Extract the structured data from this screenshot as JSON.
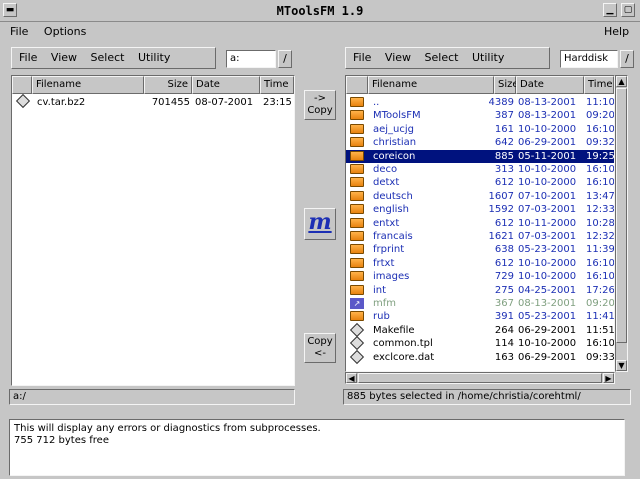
{
  "window": {
    "title": "MToolsFM 1.9"
  },
  "menubar": {
    "file": "File",
    "options": "Options",
    "help": "Help"
  },
  "left_panel": {
    "menu": [
      "File",
      "View",
      "Select",
      "Utility"
    ],
    "path": "a:",
    "slash": "/",
    "columns": [
      "Filename",
      "Size",
      "Date",
      "Time"
    ],
    "rows": [
      {
        "icon": "file-icon",
        "name": "cv.tar.bz2",
        "size": "701455",
        "date": "08-07-2001",
        "time": "23:15"
      }
    ],
    "status": "a:/"
  },
  "center": {
    "copy_right_arrow": "->",
    "copy_right_label": "Copy",
    "logo": "m",
    "copy_left_label": "Copy",
    "copy_left_arrow": "<-"
  },
  "right_panel": {
    "menu": [
      "File",
      "View",
      "Select",
      "Utility"
    ],
    "path": "Harddisk",
    "slash": "/",
    "columns": [
      "Filename",
      "Size",
      "Date",
      "Time"
    ],
    "rows": [
      {
        "icon": "folder-icon",
        "name": "..",
        "size": "4389",
        "date": "08-13-2001",
        "time": "11:10",
        "style": "blue"
      },
      {
        "icon": "folder-icon",
        "name": "MToolsFM",
        "size": "387",
        "date": "08-13-2001",
        "time": "09:20",
        "style": "blue"
      },
      {
        "icon": "folder-icon",
        "name": "aej_ucjg",
        "size": "161",
        "date": "10-10-2000",
        "time": "16:10",
        "style": "blue"
      },
      {
        "icon": "folder-icon",
        "name": "christian",
        "size": "642",
        "date": "06-29-2001",
        "time": "09:32",
        "style": "blue"
      },
      {
        "icon": "folder-icon",
        "name": "coreicon",
        "size": "885",
        "date": "05-11-2001",
        "time": "19:25",
        "style": "sel"
      },
      {
        "icon": "folder-icon",
        "name": "deco",
        "size": "313",
        "date": "10-10-2000",
        "time": "16:10",
        "style": "blue"
      },
      {
        "icon": "folder-icon",
        "name": "detxt",
        "size": "612",
        "date": "10-10-2000",
        "time": "16:10",
        "style": "blue"
      },
      {
        "icon": "folder-icon",
        "name": "deutsch",
        "size": "1607",
        "date": "07-10-2001",
        "time": "13:47",
        "style": "blue"
      },
      {
        "icon": "folder-icon",
        "name": "english",
        "size": "1592",
        "date": "07-03-2001",
        "time": "12:33",
        "style": "blue"
      },
      {
        "icon": "folder-icon",
        "name": "entxt",
        "size": "612",
        "date": "10-11-2000",
        "time": "10:28",
        "style": "blue"
      },
      {
        "icon": "folder-icon",
        "name": "francais",
        "size": "1621",
        "date": "07-03-2001",
        "time": "12:32",
        "style": "blue"
      },
      {
        "icon": "folder-icon",
        "name": "frprint",
        "size": "638",
        "date": "05-23-2001",
        "time": "11:39",
        "style": "blue"
      },
      {
        "icon": "folder-icon",
        "name": "frtxt",
        "size": "612",
        "date": "10-10-2000",
        "time": "16:10",
        "style": "blue"
      },
      {
        "icon": "folder-icon",
        "name": "images",
        "size": "729",
        "date": "10-10-2000",
        "time": "16:10",
        "style": "blue"
      },
      {
        "icon": "folder-icon",
        "name": "int",
        "size": "275",
        "date": "04-25-2001",
        "time": "17:26",
        "style": "blue"
      },
      {
        "icon": "link-icon",
        "name": "mfm",
        "size": "367",
        "date": "08-13-2001",
        "time": "09:20",
        "style": "gray"
      },
      {
        "icon": "folder-icon",
        "name": "rub",
        "size": "391",
        "date": "05-23-2001",
        "time": "11:41",
        "style": "blue"
      },
      {
        "icon": "file-icon",
        "name": "Makefile",
        "size": "264",
        "date": "06-29-2001",
        "time": "11:51",
        "style": "plain"
      },
      {
        "icon": "file-icon",
        "name": "common.tpl",
        "size": "114",
        "date": "10-10-2000",
        "time": "16:10",
        "style": "plain"
      },
      {
        "icon": "file-icon",
        "name": "exclcore.dat",
        "size": "163",
        "date": "06-29-2001",
        "time": "09:33",
        "style": "plain"
      }
    ],
    "status": "885 bytes selected in /home/christia/corehtml/"
  },
  "messages": {
    "line1": "This will display any errors or diagnostics from subprocesses.",
    "line2": "755 712 bytes free"
  }
}
